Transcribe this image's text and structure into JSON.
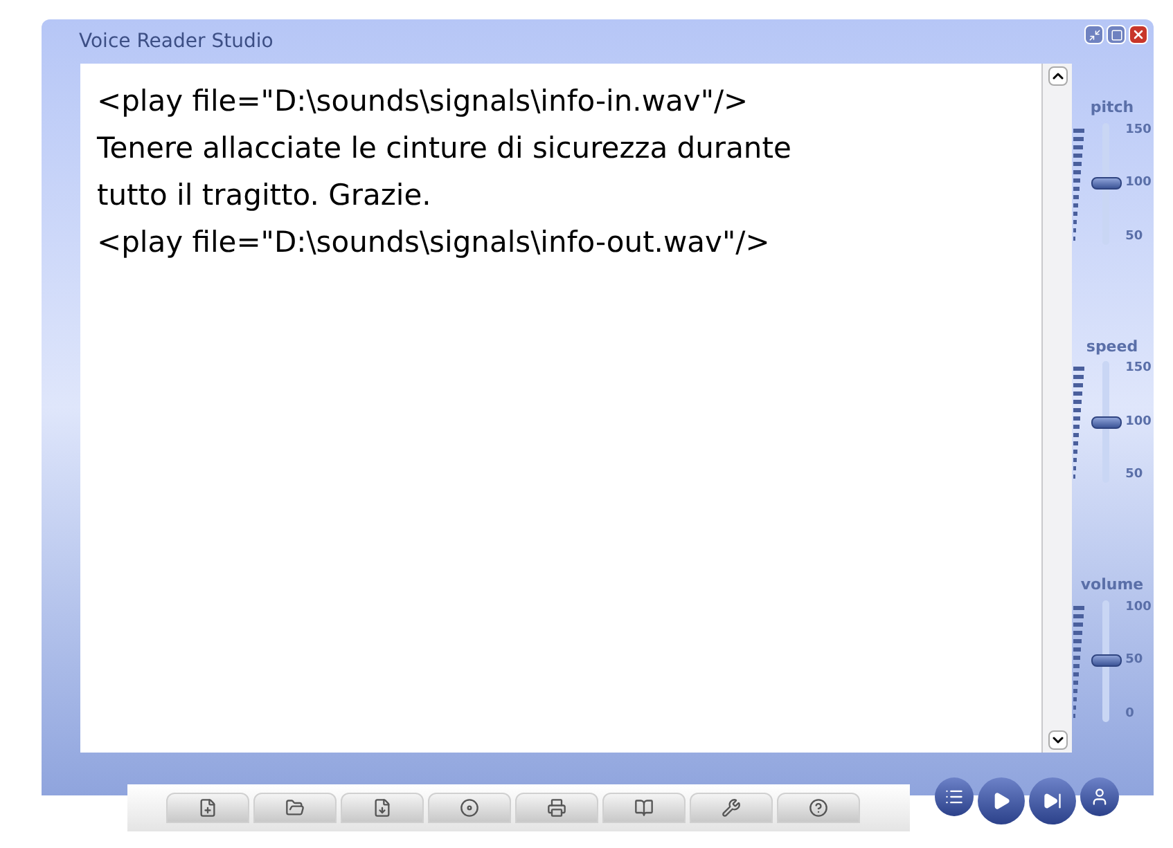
{
  "window": {
    "title": "Voice Reader Studio"
  },
  "editor": {
    "lines": [
      "<play file=\"D:\\sounds\\signals\\info-in.wav\"/>",
      "Tenere allacciate le cinture di sicurezza durante",
      "tutto il tragitto. Grazie.",
      "<play file=\"D:\\sounds\\signals\\info-out.wav\"/>"
    ]
  },
  "sliders": [
    {
      "label": "pitch",
      "ticks": [
        "150",
        "100",
        "50"
      ],
      "level": 0.5
    },
    {
      "label": "speed",
      "ticks": [
        "150",
        "100",
        "50"
      ],
      "level": 0.5
    },
    {
      "label": "volume",
      "ticks": [
        "100",
        "50",
        "0"
      ],
      "level": 0.5
    }
  ]
}
